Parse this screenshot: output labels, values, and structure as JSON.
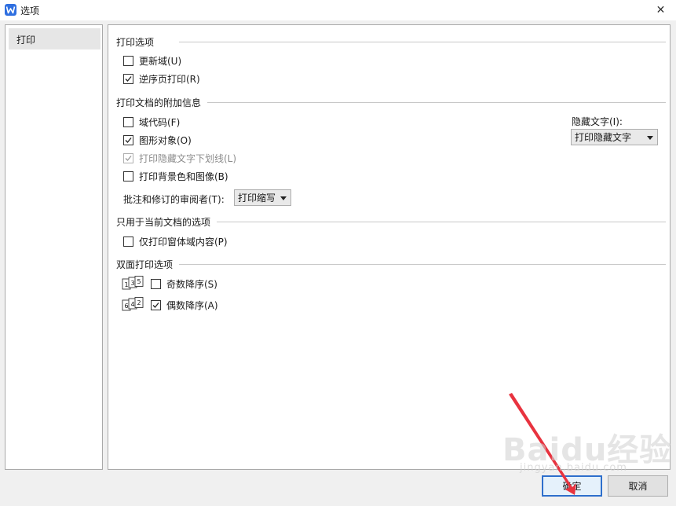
{
  "window": {
    "title": "选项",
    "close_glyph": "✕"
  },
  "sidebar": {
    "items": [
      {
        "label": "打印"
      }
    ]
  },
  "sections": {
    "print_options": {
      "title": "打印选项",
      "items": [
        {
          "label": "更新域(U)",
          "checked": false
        },
        {
          "label": "逆序页打印(R)",
          "checked": true
        }
      ]
    },
    "attach_info": {
      "title": "打印文档的附加信息",
      "items": [
        {
          "label": "域代码(F)",
          "checked": false
        },
        {
          "label": "图形对象(O)",
          "checked": true
        },
        {
          "label": "打印隐藏文字下划线(L)",
          "checked": true,
          "disabled": true
        },
        {
          "label": "打印背景色和图像(B)",
          "checked": false
        }
      ],
      "reviewer_label": "批注和修订的审阅者(T):",
      "reviewer_value": "打印缩写",
      "hidden_text_label": "隐藏文字(I):",
      "hidden_text_value": "打印隐藏文字"
    },
    "current_doc": {
      "title": "只用于当前文档的选项",
      "items": [
        {
          "label": "仅打印窗体域内容(P)",
          "checked": false
        }
      ]
    },
    "duplex": {
      "title": "双面打印选项",
      "items": [
        {
          "label": "奇数降序(S)",
          "checked": false,
          "icon_digits": [
            "1",
            "3",
            "5"
          ]
        },
        {
          "label": "偶数降序(A)",
          "checked": true,
          "icon_digits": [
            "6",
            "4",
            "2"
          ]
        }
      ]
    }
  },
  "footer": {
    "ok_label": "确定",
    "cancel_label": "取消"
  },
  "watermark": {
    "brand": "Baidu经验",
    "url": "jingyan.baidu.com"
  },
  "colors": {
    "accent": "#2e6fcc",
    "annotation_arrow": "#e8333f",
    "app_logo": "#2f6fe0"
  }
}
